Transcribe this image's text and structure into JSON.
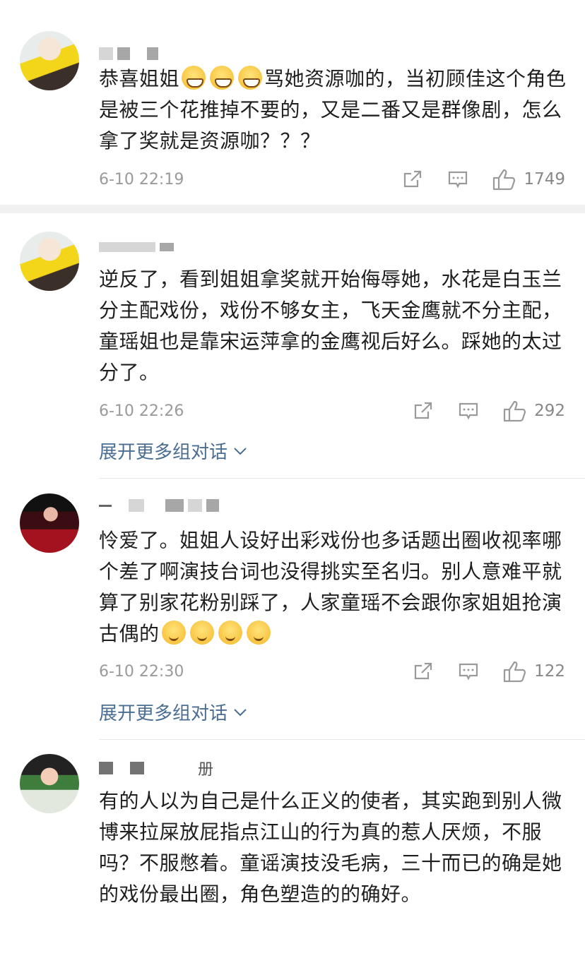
{
  "comments": [
    {
      "user": "",
      "text_before": "恭喜姐姐",
      "emoji": [
        "grin",
        "grin",
        "grin"
      ],
      "text_after": "骂她资源咖的，当初顾佳这个角色是被三个花推掉不要的，又是二番又是群像剧，怎么拿了奖就是资源咖？？？",
      "time": "6-10 22:19",
      "likes": "1749",
      "expand": ""
    },
    {
      "user": "",
      "text": "逆反了，看到姐姐拿奖就开始侮辱她，水花是白玉兰分主配戏份，戏份不够女主，飞天金鹰就不分主配，童瑶姐也是靠宋运萍拿的金鹰视后好么。踩她的太过分了。",
      "time": "6-10 22:26",
      "likes": "292",
      "expand": "展开更多组对话"
    },
    {
      "user": "",
      "text_before": "怜爱了。姐姐人设好出彩戏份也多话题出圈收视率哪个差了啊演技台词也没得挑实至名归。别人意难平就算了别家花粉别踩了，人家童瑶不会跟你家姐姐抢演古偶的",
      "emoji": [
        "blush",
        "blush",
        "blush",
        "blush"
      ],
      "time": "6-10 22:30",
      "likes": "122",
      "expand": "展开更多组对话"
    },
    {
      "user": "册",
      "text": "有的人以为自己是什么正义的使者，其实跑到别人微博来拉屎放屁指点江山的行为真的惹人厌烦，不服吗？不服憋着。童谣演技没毛病，三十而已的确是她的戏份最出圈，角色塑造的的确好。"
    }
  ],
  "icons": {
    "share": "share-icon",
    "reply": "comment-icon",
    "like": "thumbs-up-icon",
    "chevron": "chevron-down-icon"
  },
  "colors": {
    "link": "#4a6d92",
    "meta": "#9a9a9a",
    "text": "#1f1f1f"
  }
}
